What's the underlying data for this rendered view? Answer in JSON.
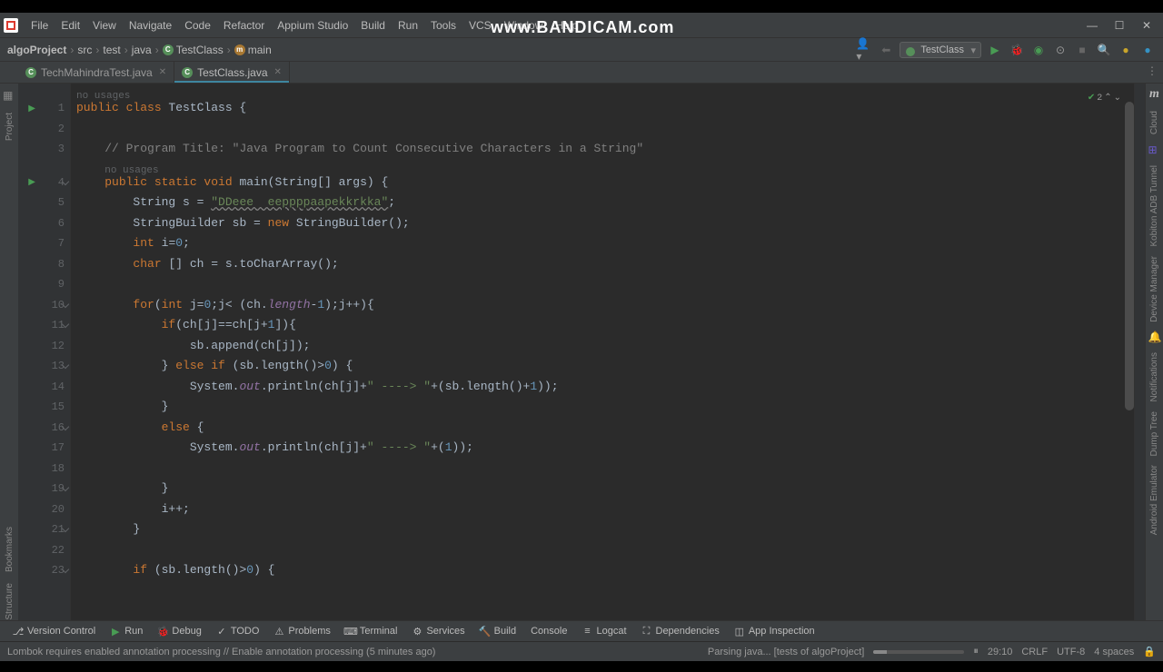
{
  "watermark": "www.BANDICAM.com",
  "menu": [
    "File",
    "Edit",
    "View",
    "Navigate",
    "Code",
    "Refactor",
    "Appium Studio",
    "Build",
    "Run",
    "Tools",
    "VCS",
    "Window",
    "Help"
  ],
  "breadcrumb": {
    "project": "algoProject",
    "parts": [
      "src",
      "test",
      "java"
    ],
    "class": "TestClass",
    "method": "main"
  },
  "toolbar": {
    "run_config": "TestClass"
  },
  "tabs": [
    {
      "name": "TechMahindraTest.java",
      "active": false
    },
    {
      "name": "TestClass.java",
      "active": true
    }
  ],
  "inspection": {
    "warnings": "2"
  },
  "hints": {
    "no_usages": "no usages"
  },
  "code": {
    "l1": {
      "a": "public class ",
      "b": "TestClass {"
    },
    "l3": "// Program Title: \"Java Program to Count Consecutive Characters in a String\"",
    "l4": {
      "a": "public static void ",
      "b": "main(String[] args) {"
    },
    "l5": {
      "a": "String s = ",
      "b": "\"DDeee  eeppppaapekkrkka\"",
      "c": ";"
    },
    "l6": {
      "a": "StringBuilder sb = ",
      "b": "new ",
      "c": "StringBuilder();"
    },
    "l7": {
      "a": "int ",
      "b": "i=",
      "c": "0",
      "d": ";"
    },
    "l8": {
      "a": "char ",
      "b": "[] ch = s.toCharArray();"
    },
    "l10": {
      "a": "for",
      "b": "(",
      "c": "int ",
      "d": "j=",
      "e": "0",
      "f": ";j< (ch.",
      "g": "length",
      "h": "-",
      "i": "1",
      "j": ");j++){"
    },
    "l11": {
      "a": "if",
      "b": "(ch[j]==ch[j+",
      "c": "1",
      "d": "]){"
    },
    "l12": "sb.append(ch[j]);",
    "l13": {
      "a": "} ",
      "b": "else if ",
      "c": "(sb.length()>",
      "d": "0",
      "e": ") {"
    },
    "l14": {
      "a": "System.",
      "b": "out",
      "c": ".println(ch[j]+",
      "d": "\" ----> \"",
      "e": "+(sb.length()+",
      "f": "1",
      "g": "));"
    },
    "l15": "}",
    "l16": {
      "a": "else ",
      "b": "{"
    },
    "l17": {
      "a": "System.",
      "b": "out",
      "c": ".println(ch[j]+",
      "d": "\" ----> \"",
      "e": "+(",
      "f": "1",
      "g": "));"
    },
    "l19": "}",
    "l20": "i++;",
    "l21": "}",
    "l23": {
      "a": "if ",
      "b": "(sb.length()>",
      "c": "0",
      "d": ") {"
    }
  },
  "bottom_tools": [
    "Version Control",
    "Run",
    "Debug",
    "TODO",
    "Problems",
    "Terminal",
    "Services",
    "Build",
    "Console",
    "Logcat",
    "Dependencies",
    "App Inspection"
  ],
  "status": {
    "message": "Lombok requires enabled annotation processing // Enable annotation processing (5 minutes ago)",
    "indexing": "Parsing java... [tests of algoProject]",
    "line_col": "29:10",
    "line_sep": "CRLF",
    "encoding": "UTF-8",
    "indent": "4 spaces"
  },
  "right_rail": [
    "Cloud",
    "Kobiton ADB Tunnel",
    "Device Manager",
    "Notifications",
    "Dump Tree",
    "Android Emulator"
  ],
  "left_rail": [
    "Project",
    "Bookmarks",
    "Structure"
  ]
}
